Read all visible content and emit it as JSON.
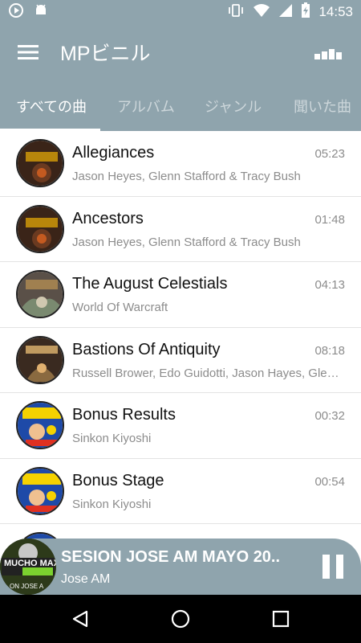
{
  "status_bar": {
    "time": "14:53",
    "icons": [
      "play-circle-icon",
      "android-icon",
      "vibrate-icon",
      "wifi-icon",
      "signal-icon",
      "battery-charging-icon"
    ]
  },
  "app_bar": {
    "title": "MPビニル",
    "menu_icon": "hamburger-menu-icon",
    "equalizer_icon": "equalizer-icon"
  },
  "tabs": [
    {
      "label": "すべての曲",
      "active": true
    },
    {
      "label": "アルバム",
      "active": false
    },
    {
      "label": "ジャンル",
      "active": false
    },
    {
      "label": "聞いた曲",
      "active": false
    }
  ],
  "songs": [
    {
      "title": "Allegiances",
      "artist": "Jason Heyes, Glenn Stafford & Tracy Bush",
      "duration": "05:23"
    },
    {
      "title": "Ancestors",
      "artist": "Jason Heyes, Glenn Stafford & Tracy Bush",
      "duration": "01:48"
    },
    {
      "title": "The August Celestials",
      "artist": "World Of Warcraft",
      "duration": "04:13"
    },
    {
      "title": "Bastions Of Antiquity",
      "artist": "Russell Brower, Edo Guidotti, Jason Hayes, Glenn Stafford",
      "duration": "08:18"
    },
    {
      "title": "Bonus Results",
      "artist": "Sinkon Kiyoshi",
      "duration": "00:32"
    },
    {
      "title": "Bonus Stage",
      "artist": "Sinkon Kiyoshi",
      "duration": "00:54"
    }
  ],
  "now_playing": {
    "title": "SESION JOSE AM MAYO 20..",
    "artist": "Jose AM",
    "art_text": "MUCHO MAX",
    "art_subtext": "ON JOSE A"
  },
  "colors": {
    "primary": "#8fa4ad",
    "text_primary": "#111111",
    "text_secondary": "#8c8c8c"
  }
}
